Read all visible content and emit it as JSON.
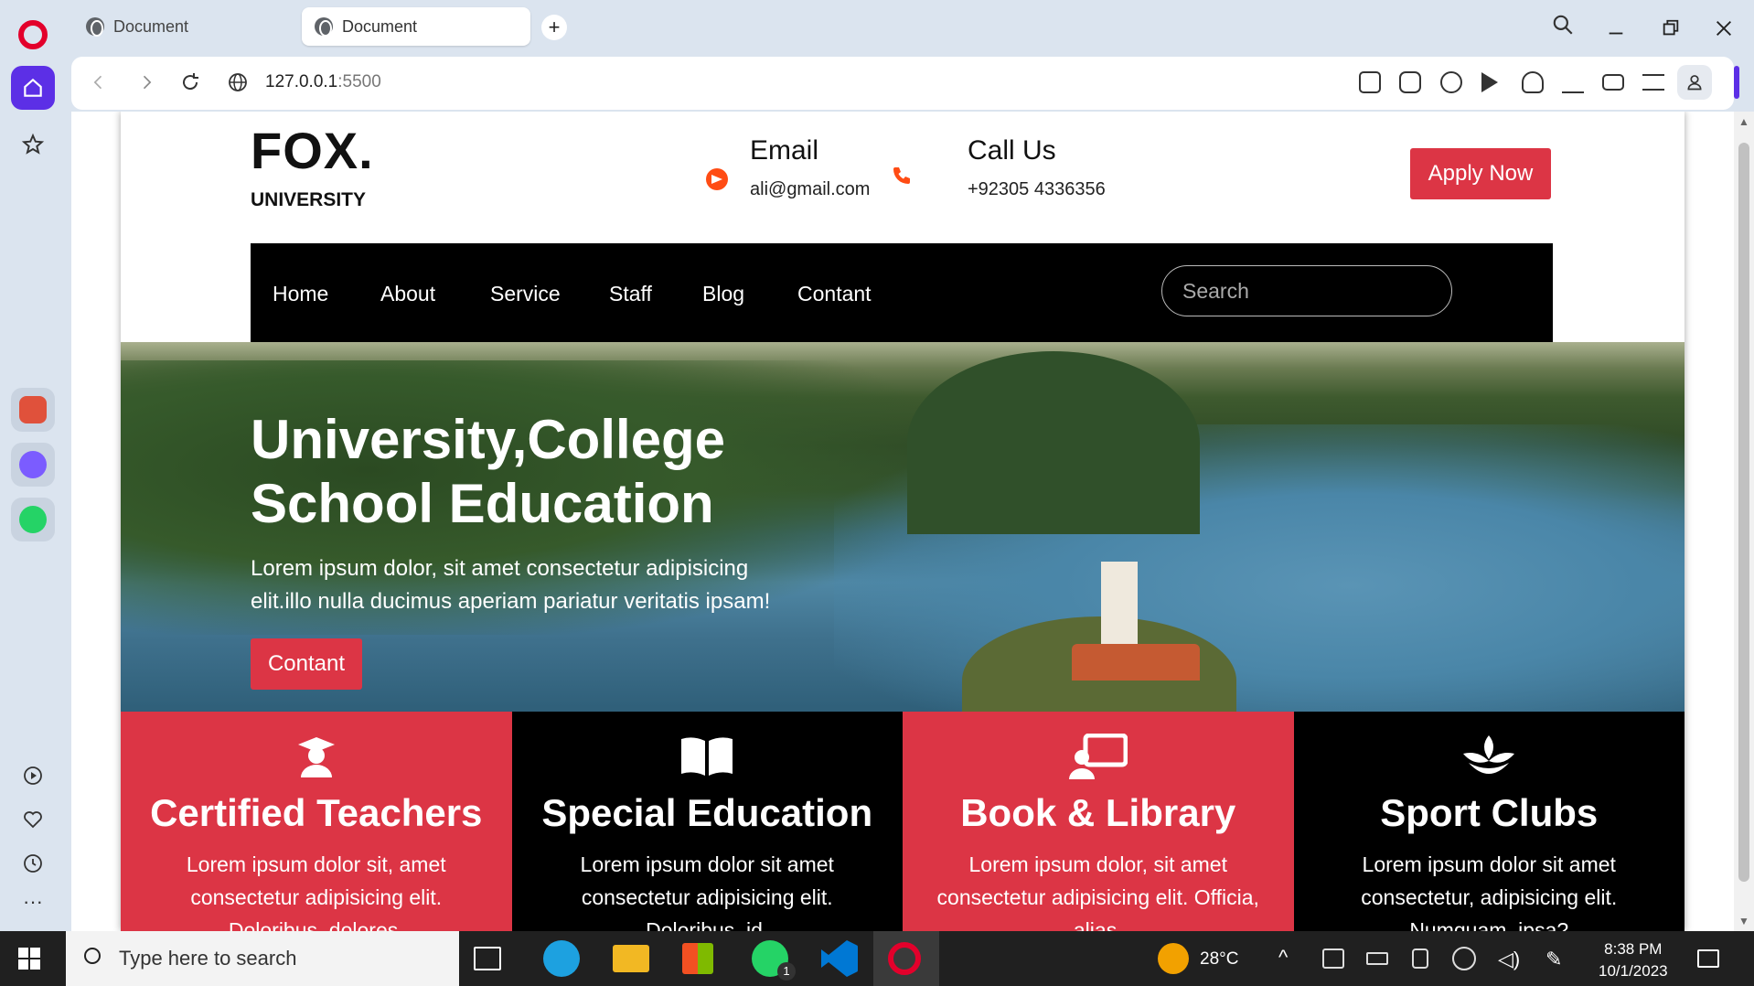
{
  "browser": {
    "tabs": [
      {
        "label": "Document",
        "active": false
      },
      {
        "label": "Document",
        "active": true
      }
    ],
    "new_tab": "+",
    "url_host": "127.0.0.1",
    "url_port": ":5500"
  },
  "site": {
    "logo": "FOX.",
    "logo_sub": "UNIVERSITY",
    "email_label": "Email",
    "email_value": "ali@gmail.com",
    "call_label": "Call Us",
    "call_value": "+92305 4336356",
    "apply_button": "Apply Now",
    "nav": [
      "Home",
      "About",
      "Service",
      "Staff",
      "Blog",
      "Contant"
    ],
    "search_placeholder": "Search",
    "hero": {
      "title_line1": "University,College",
      "title_line2": "School Education",
      "text_line1": "Lorem ipsum dolor, sit amet consectetur adipisicing",
      "text_line2": "elit.illo nulla ducimus aperiam pariatur veritatis ipsam!",
      "button": "Contant"
    },
    "features": [
      {
        "icon": "graduate-icon",
        "title": "Certified Teachers",
        "line1": "Lorem ipsum dolor sit, amet",
        "line2": "consectetur adipisicing elit.",
        "line3": "Doloribus, dolores.",
        "color": "#dc3545"
      },
      {
        "icon": "book-icon",
        "title": "Special Education",
        "line1": "Lorem ipsum dolor sit amet",
        "line2": "consectetur adipisicing elit.",
        "line3": "Doloribus, id.",
        "color": "#000000"
      },
      {
        "icon": "teacher-board-icon",
        "title": "Book & Library",
        "line1": "Lorem ipsum dolor, sit amet",
        "line2": "consectetur adipisicing elit. Officia,",
        "line3": "alias.",
        "color": "#dc3545"
      },
      {
        "icon": "lotus-icon",
        "title": "Sport Clubs",
        "line1": "Lorem ipsum dolor sit amet",
        "line2": "consectetur, adipisicing elit.",
        "line3": "Numquam, ipsa?",
        "color": "#000000"
      }
    ]
  },
  "taskbar": {
    "search_placeholder": "Type here to search",
    "temperature": "28°C",
    "time": "8:38 PM",
    "date": "10/1/2023",
    "whatsapp_badge": "1"
  },
  "colors": {
    "accent_red": "#dc3545",
    "opera_purple": "#5c2fe6",
    "icon_orange": "#ff4c14"
  }
}
